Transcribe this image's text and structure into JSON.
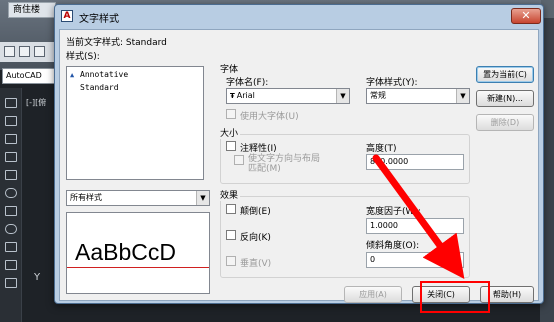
{
  "background": {
    "tab_label": "商住楼",
    "combo_label": "AutoCAD",
    "viewport_label": "[-][俯",
    "ucs_label": "Y"
  },
  "dialog": {
    "title": "文字样式",
    "title_icon_letter": "A",
    "close_symbol": "✕",
    "current_style": "当前文字样式: Standard",
    "styles_label": "样式(S):",
    "styles": [
      {
        "name": "Annotative",
        "icon": "annotative-icon"
      },
      {
        "name": "Standard",
        "icon": ""
      }
    ],
    "filter": {
      "value": "所有样式"
    },
    "preview_text": "AaBbCcD",
    "font": {
      "group_label": "字体",
      "name_label": "字体名(F):",
      "name_value": "Arial",
      "name_icon": "truetype-icon",
      "style_label": "字体样式(Y):",
      "style_value": "常规",
      "bigfont_label": "使用大字体(U)"
    },
    "size": {
      "group_label": "大小",
      "annotative_label": "注释性(I)",
      "match_label_line1": "使文字方向与布局",
      "match_label_line2": "匹配(M)",
      "height_label": "高度(T)",
      "height_value": "800.0000"
    },
    "effects": {
      "group_label": "效果",
      "upside_down_label": "颠倒(E)",
      "backwards_label": "反向(K)",
      "vertical_label": "垂直(V)",
      "width_factor_label": "宽度因子(W):",
      "width_factor_value": "1.0000",
      "oblique_label": "倾斜角度(O):",
      "oblique_value": "0"
    },
    "buttons": {
      "set_current": "置为当前(C)",
      "new": "新建(N)...",
      "delete": "删除(D)",
      "apply": "应用(A)",
      "close": "关闭(C)",
      "help": "帮助(H)"
    },
    "dropdown_arrow": "▼"
  },
  "colors": {
    "annotation_arrow": "#ff0000",
    "highlight_box": "#ff0000",
    "dialog_frame": "#b8cde3"
  }
}
